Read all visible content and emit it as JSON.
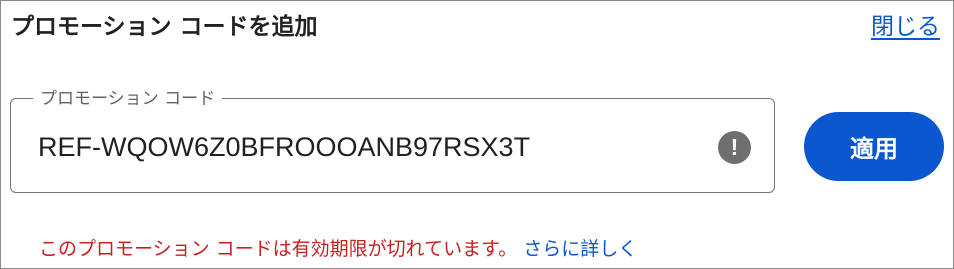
{
  "header": {
    "title": "プロモーション コードを追加",
    "close_label": "閉じる"
  },
  "promo_field": {
    "label": "プロモーション コード",
    "value": "REF-WQOW6Z0BFROOOANB97RSX3T",
    "error_icon_glyph": "!",
    "error_icon_name": "exclamation-circle-icon"
  },
  "apply_button": {
    "label": "適用"
  },
  "error": {
    "message": "このプロモーション コードは有効期限が切れています。",
    "learn_more_label": "さらに詳しく"
  },
  "colors": {
    "accent": "#0b57d0",
    "error": "#c5221f",
    "icon_gray": "#6f6f6f",
    "border": "#747775"
  }
}
